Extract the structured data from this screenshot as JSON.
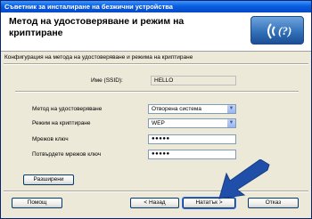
{
  "window": {
    "title": "Съветник за инсталиране на безжични устройства"
  },
  "header": {
    "title": "Метод на удостоверяване и режим на криптиране",
    "logo_icon": "wireless-signal-icon"
  },
  "subtitle": "Конфигурация на метода на удостоверяване и режима на криптиране",
  "ssid": {
    "label": "Име (SSID):",
    "value": "HELLO"
  },
  "fields": {
    "auth": {
      "label": "Метод на удостоверяване",
      "value": "Отворена система"
    },
    "encryption": {
      "label": "Режим на криптиране",
      "value": "WEP"
    },
    "key": {
      "label": "Мрежов ключ",
      "value": "●●●●●"
    },
    "confirm": {
      "label": "Потвърдете мрежов ключ",
      "value": "●●●●●"
    }
  },
  "buttons": {
    "advanced": "Разширени",
    "help": "Помощ",
    "back": "< Назад",
    "next": "Нататък >",
    "cancel": "Отказ"
  },
  "colors": {
    "title_bar": "#0a5ee0",
    "arrow": "#1f4fa8"
  }
}
